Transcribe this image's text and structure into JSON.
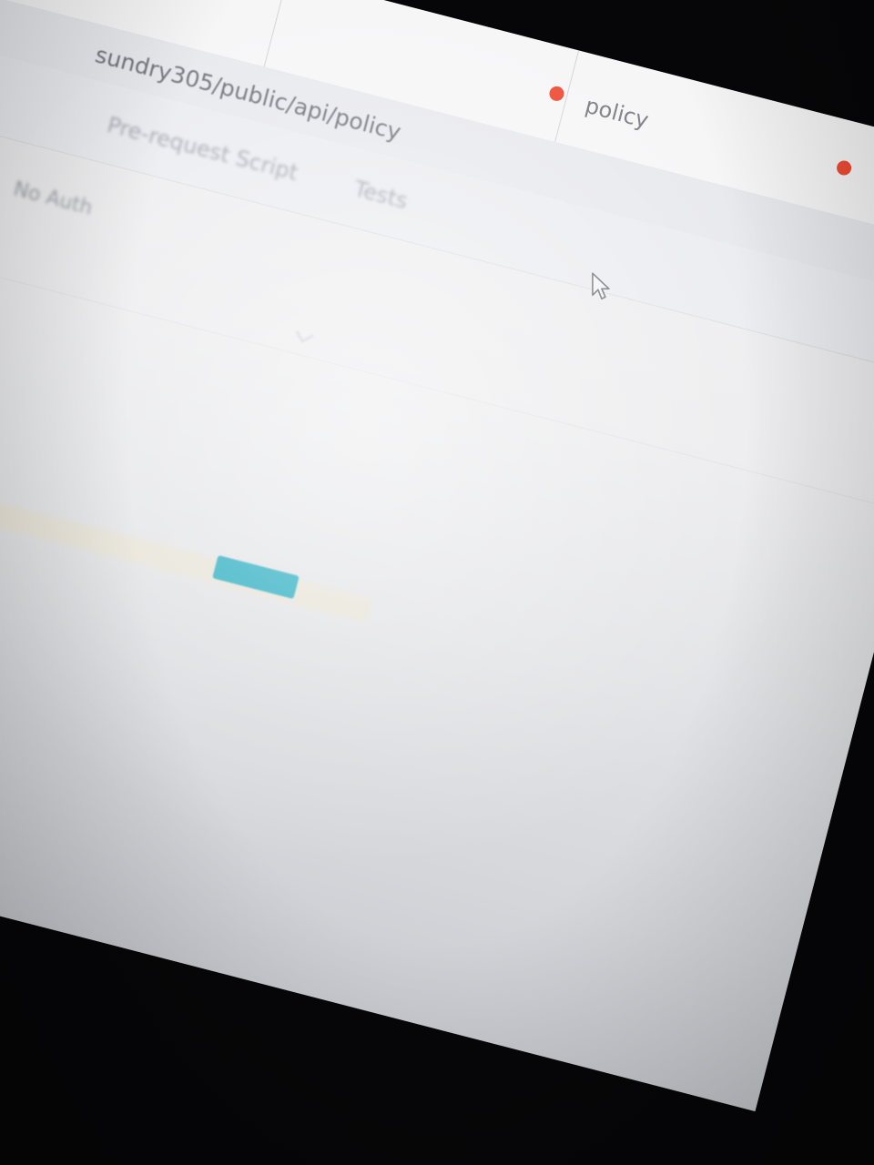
{
  "tabs": [
    {
      "label": "",
      "has_unsaved_dot": true
    },
    {
      "label": "policy",
      "has_unsaved_dot": true
    }
  ],
  "request": {
    "url_fragment": "sundry305/public/api/policy"
  },
  "request_tabs": [
    {
      "label": "Pre-request Script"
    },
    {
      "label": "Tests"
    }
  ],
  "auth": {
    "type": "No Auth"
  },
  "colors": {
    "accent": "#20a9bd",
    "unsaved_dot": "#ef4b33",
    "background": "#ececee"
  },
  "icons": {
    "pointer": "mouse-pointer-icon",
    "chevron": "chevron-down-icon"
  }
}
